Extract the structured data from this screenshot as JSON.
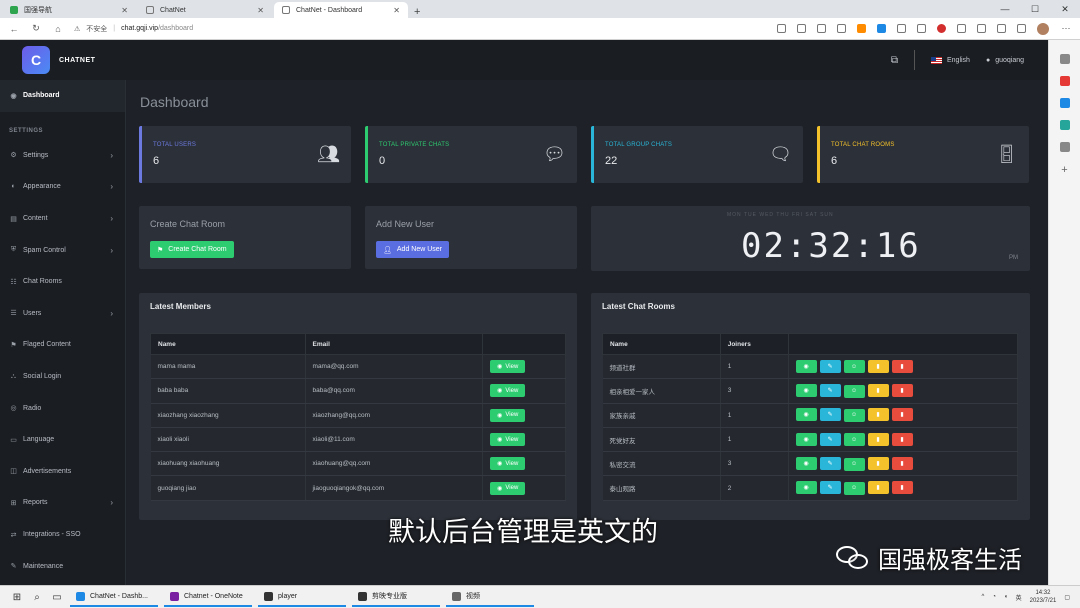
{
  "browser": {
    "tabs": [
      {
        "label": "国强导航"
      },
      {
        "label": "ChatNet"
      },
      {
        "label": "ChatNet - Dashboard",
        "active": true
      }
    ],
    "security_label": "不安全",
    "url_host": "chat.gqji.vip",
    "url_path": "/dashboard"
  },
  "header": {
    "brand": "CHATNET",
    "brand_logo_letter": "C",
    "language": "English",
    "user": "guoqiang"
  },
  "sidebar": {
    "dashboard": "Dashboard",
    "section_label": "SETTINGS",
    "items": [
      {
        "label": "Settings",
        "has_children": true
      },
      {
        "label": "Appearance",
        "has_children": true
      },
      {
        "label": "Content",
        "has_children": true
      },
      {
        "label": "Spam Control",
        "has_children": true
      },
      {
        "label": "Chat Rooms",
        "has_children": false
      },
      {
        "label": "Users",
        "has_children": true
      },
      {
        "label": "Flaged Content",
        "has_children": false
      },
      {
        "label": "Social Login",
        "has_children": false
      },
      {
        "label": "Radio",
        "has_children": false
      },
      {
        "label": "Language",
        "has_children": false
      },
      {
        "label": "Advertisements",
        "has_children": false
      },
      {
        "label": "Reports",
        "has_children": true
      },
      {
        "label": "Integrations - SSO",
        "has_children": false
      },
      {
        "label": "Maintenance",
        "has_children": false
      }
    ]
  },
  "page": {
    "title": "Dashboard"
  },
  "stats": [
    {
      "label": "TOTAL USERS",
      "value": "6",
      "color": "#6c7ae0",
      "icon": "users-icon"
    },
    {
      "label": "TOTAL PRIVATE CHATS",
      "value": "0",
      "color": "#2ecc71",
      "icon": "comment-icon"
    },
    {
      "label": "TOTAL GROUP CHATS",
      "value": "22",
      "color": "#29b6d8",
      "icon": "comments-icon"
    },
    {
      "label": "TOTAL CHAT ROOMS",
      "value": "6",
      "color": "#f4c22b",
      "icon": "door-icon"
    }
  ],
  "create_room": {
    "title": "Create Chat Room",
    "button": "Create Chat Room"
  },
  "add_user": {
    "title": "Add New User",
    "button": "Add New User"
  },
  "clock": {
    "days": "MON  TUE  WED  THU  FRI  SAT  SUN",
    "time": "02:32:16",
    "ampm": "PM"
  },
  "latest_members": {
    "title": "Latest Members",
    "columns": [
      "Name",
      "Email",
      ""
    ],
    "view_label": "View",
    "rows": [
      {
        "name": "mama mama",
        "email": "mama@qq.com"
      },
      {
        "name": "baba baba",
        "email": "baba@qq.com"
      },
      {
        "name": "xiaozhang xiaozhang",
        "email": "xiaozhang@qq.com"
      },
      {
        "name": "xiaoli xiaoli",
        "email": "xiaoli@11.com"
      },
      {
        "name": "xiaohuang xiaohuang",
        "email": "xiaohuang@qq.com"
      },
      {
        "name": "guoqiang jiao",
        "email": "jiaoguoqiangok@qq.com"
      }
    ]
  },
  "latest_rooms": {
    "title": "Latest Chat Rooms",
    "columns": [
      "Name",
      "Joiners",
      ""
    ],
    "rows": [
      {
        "name": "频道社群",
        "joiners": "1"
      },
      {
        "name": "相亲相爱一家人",
        "joiners": "3"
      },
      {
        "name": "家族亲戚",
        "joiners": "1"
      },
      {
        "name": "死党好友",
        "joiners": "1"
      },
      {
        "name": "私密交流",
        "joiners": "3"
      },
      {
        "name": "泰山观路",
        "joiners": "2"
      }
    ]
  },
  "overlay": {
    "subtitle": "默认后台管理是英文的",
    "watermark": "国强极客生活"
  },
  "taskbar": {
    "apps": [
      {
        "label": "ChatNet - Dashb..."
      },
      {
        "label": "Chatnet - OneNote"
      },
      {
        "label": "player"
      },
      {
        "label": "剪映专业版"
      },
      {
        "label": "视频"
      }
    ],
    "ime": "英",
    "time": "14:32",
    "date": "2023/7/21"
  }
}
